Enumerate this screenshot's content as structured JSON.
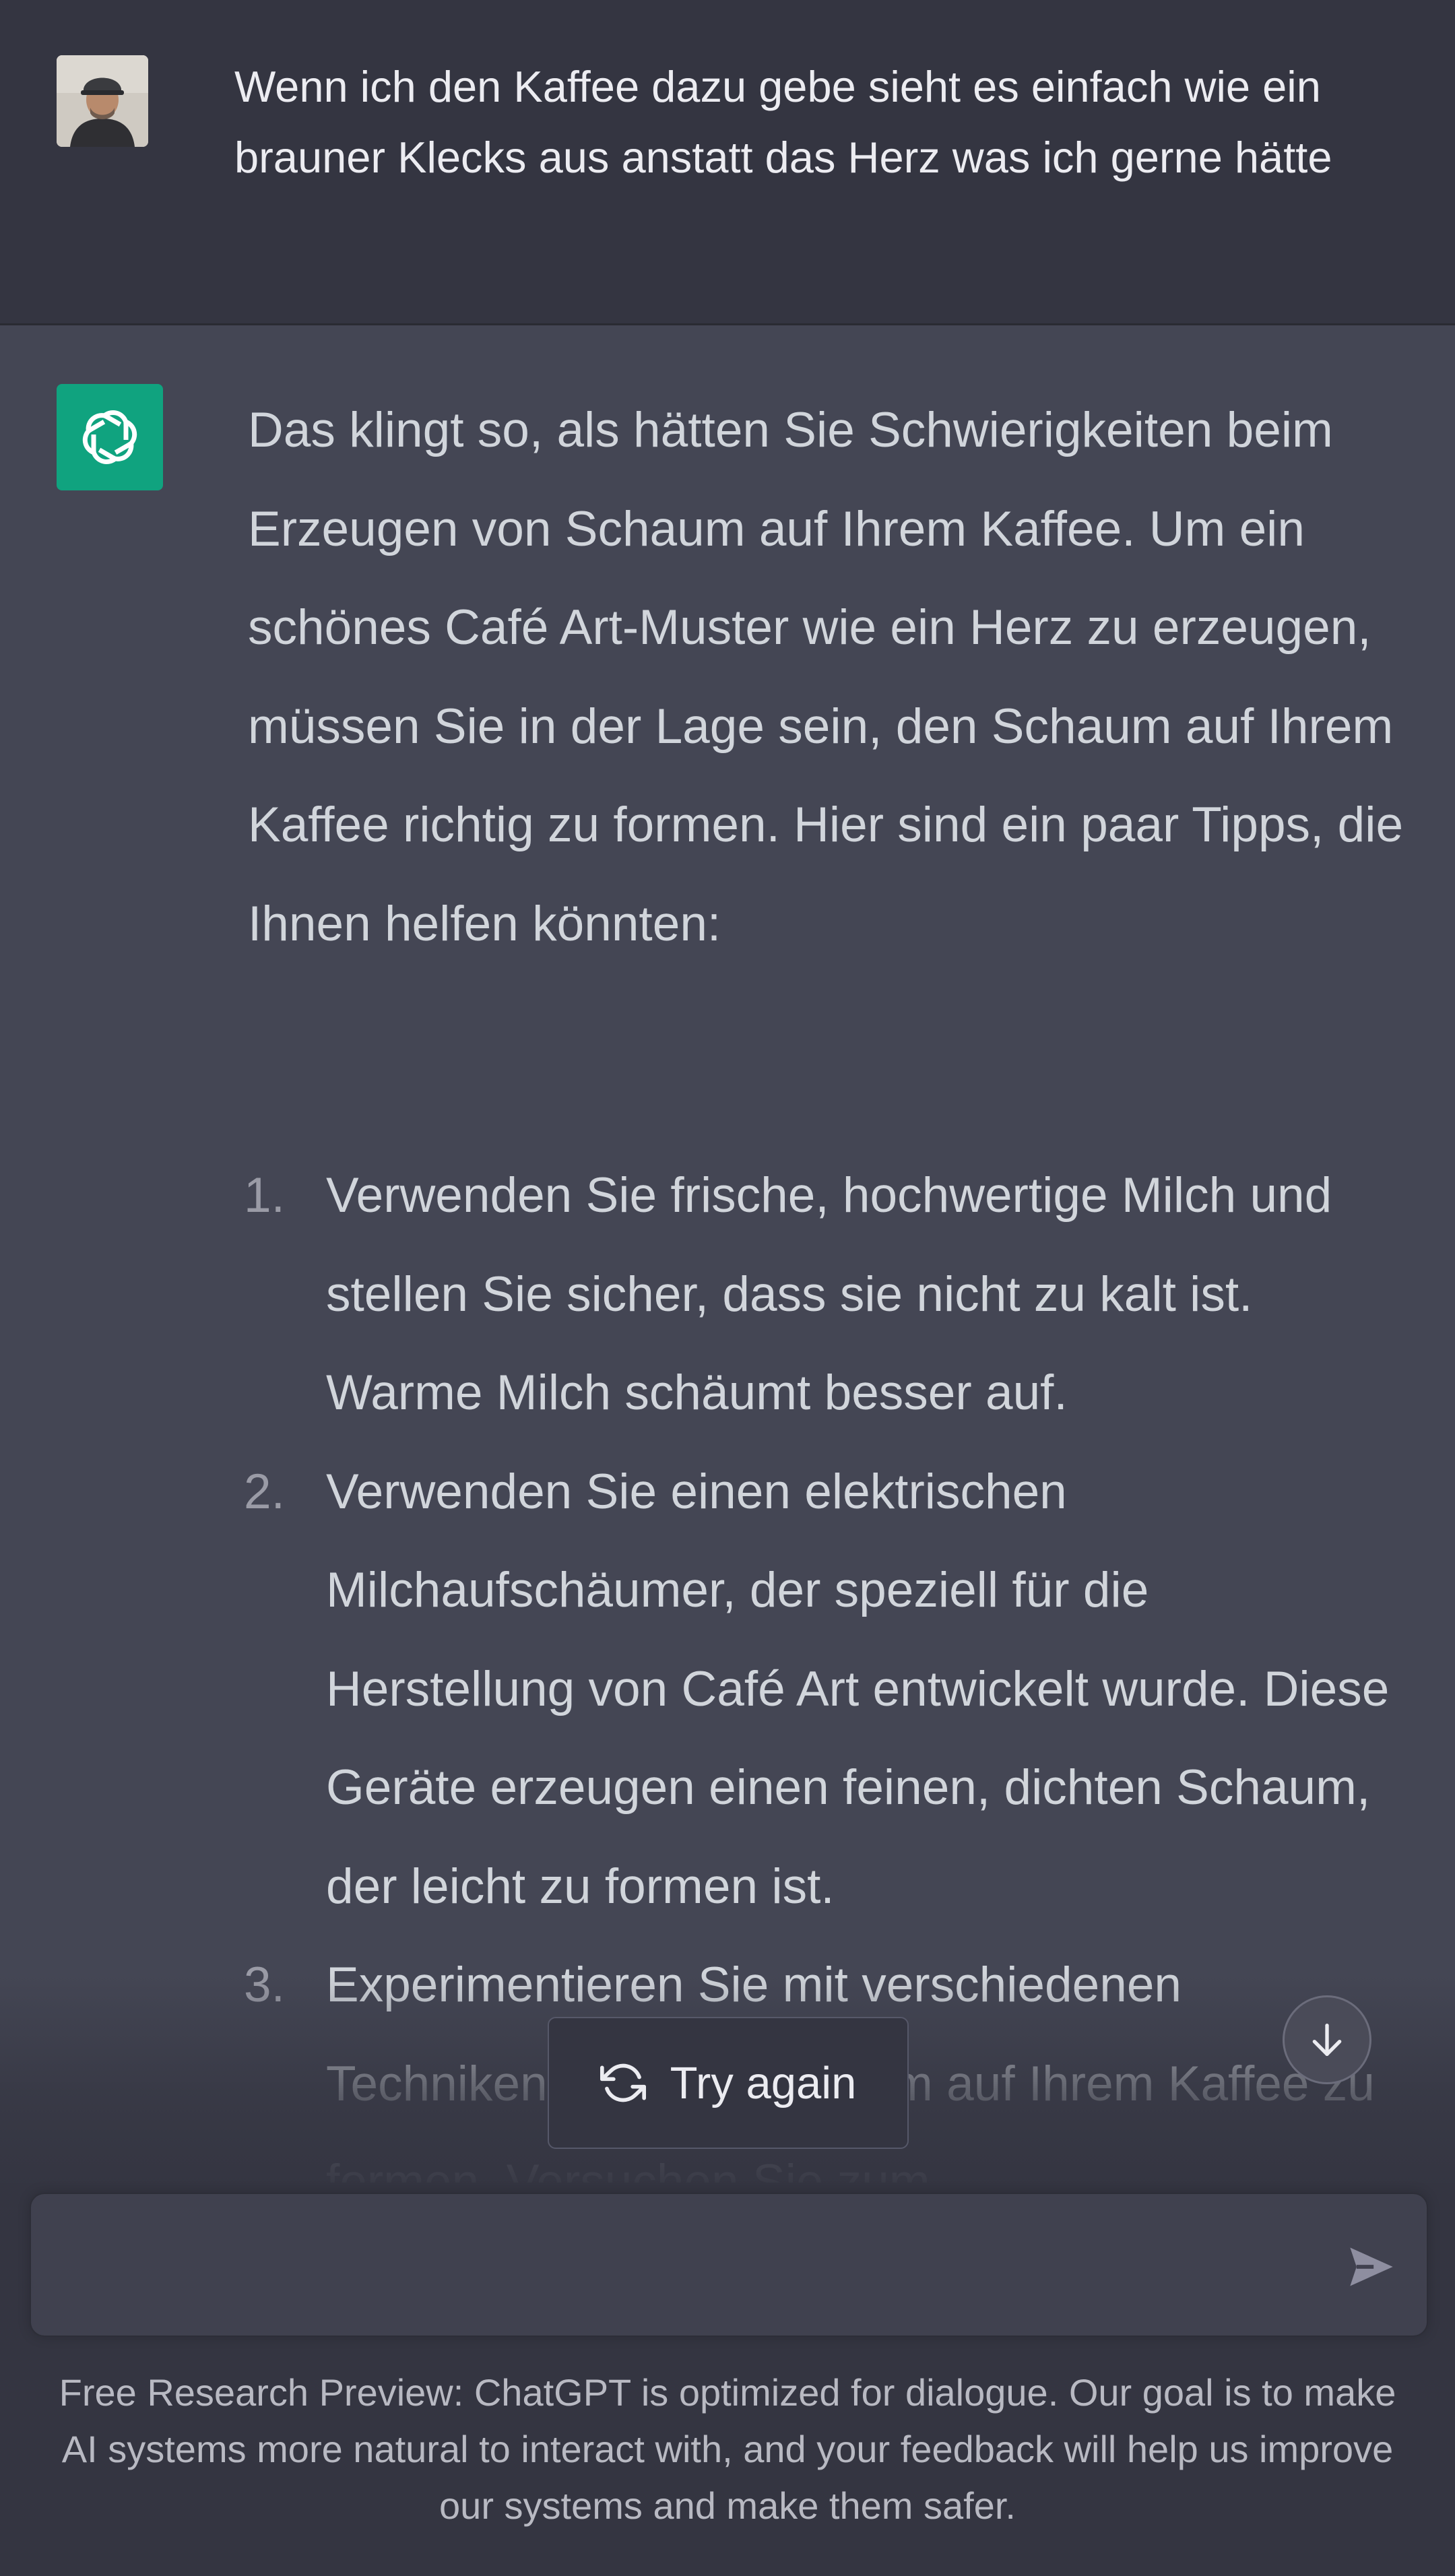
{
  "user_message": {
    "text": "Wenn ich den Kaffee dazu gebe sieht es einfach wie ein brauner Klecks aus anstatt das Herz was ich gerne hätte",
    "avatar_icon": "user-avatar-photo"
  },
  "assistant_message": {
    "avatar_icon": "openai-logo-icon",
    "avatar_color": "#10a37f",
    "intro": "Das klingt so, als hätten Sie Schwierigkeiten beim Erzeugen von Schaum auf Ihrem Kaffee. Um ein schönes Café Art-Muster wie ein Herz zu erzeugen, müssen Sie in der Lage sein, den Schaum auf Ihrem Kaffee richtig zu formen. Hier sind ein paar Tipps, die Ihnen helfen könnten:",
    "tips": [
      {
        "number": "1.",
        "text": "Verwenden Sie frische, hochwertige Milch und stellen Sie sicher, dass sie nicht zu kalt ist. Warme Milch schäumt besser auf."
      },
      {
        "number": "2.",
        "text": "Verwenden Sie einen elektrischen Milchaufschäumer, der speziell für die Herstellung von Café Art entwickelt wurde. Diese Geräte erzeugen einen feinen, dichten Schaum, der leicht zu formen ist."
      },
      {
        "number": "3.",
        "text": "Experimentieren Sie mit verschiedenen Techniken, um den Schaum auf Ihrem Kaffee zu formen. Versuchen Sie zum"
      }
    ]
  },
  "controls": {
    "try_again_label": "Try again",
    "try_again_icon": "refresh-icon",
    "scroll_down_icon": "arrow-down-icon",
    "send_icon": "send-icon",
    "input_value": ""
  },
  "footer": {
    "disclaimer": "Free Research Preview: ChatGPT is optimized for dialogue. Our goal is to make AI systems more natural to interact with, and your feedback will help us improve our systems and make them safer."
  },
  "colors": {
    "page_bg": "#444654",
    "user_bg": "#343541",
    "text": "#d1d5db",
    "accent": "#10a37f"
  }
}
